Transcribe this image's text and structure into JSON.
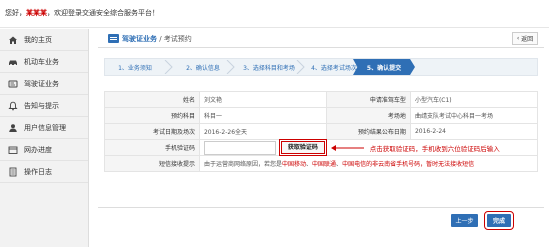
{
  "topbar": {
    "greeting_prefix": "您好，",
    "user_name": "某某某",
    "greeting_suffix": "，欢迎登录交通安全综合服务平台！"
  },
  "sidebar": {
    "items": [
      {
        "label": "我的主页",
        "icon": "home-icon"
      },
      {
        "label": "机动车业务",
        "icon": "car-icon"
      },
      {
        "label": "驾驶证业务",
        "icon": "license-icon"
      },
      {
        "label": "告知与提示",
        "icon": "bell-icon"
      },
      {
        "label": "用户信息管理",
        "icon": "user-icon"
      },
      {
        "label": "网办进度",
        "icon": "progress-icon"
      },
      {
        "label": "操作日志",
        "icon": "log-icon"
      }
    ]
  },
  "header": {
    "section": "驾驶证业务",
    "separator": " / ",
    "page": "考试预约",
    "back_label": "返回"
  },
  "steps": [
    {
      "label": "1、业务须知"
    },
    {
      "label": "2、确认信息"
    },
    {
      "label": "3、选择科目和考场"
    },
    {
      "label": "4、选择考试场次"
    },
    {
      "label": "5、确认提交"
    }
  ],
  "form": {
    "name_label": "姓名",
    "name_value": "刘文艳",
    "vehicle_label": "申请准驾车型",
    "vehicle_value": "小型汽车(C1)",
    "subject_label": "预约科目",
    "subject_value": "科目一",
    "venue_label": "考场地",
    "venue_value": "曲靖支队考试中心科目一考场",
    "date_label": "考试日期及场次",
    "date_value": "2016-2-26全天",
    "publish_label": "预约结果公布日期",
    "publish_value": "2016-2-24",
    "code_label": "手机验证码",
    "code_value": "",
    "get_code_label": "获取验证码",
    "code_hint": "点击获取验证码，手机收到六位验证码后输入",
    "sms_label": "短信接收提示",
    "sms_notice_1": "由于运营商网络原因，若您是",
    "sms_notice_2": "中国移动",
    "sms_notice_3": "、",
    "sms_notice_4": "中国联通",
    "sms_notice_5": "、",
    "sms_notice_6": "中国电信",
    "sms_notice_7": "的非云南省手机号码，暂时无法接收短信"
  },
  "footer": {
    "prev_label": "上一步",
    "done_label": "完成"
  },
  "colors": {
    "accent": "#2f6fb5",
    "highlight": "#cc0000"
  }
}
